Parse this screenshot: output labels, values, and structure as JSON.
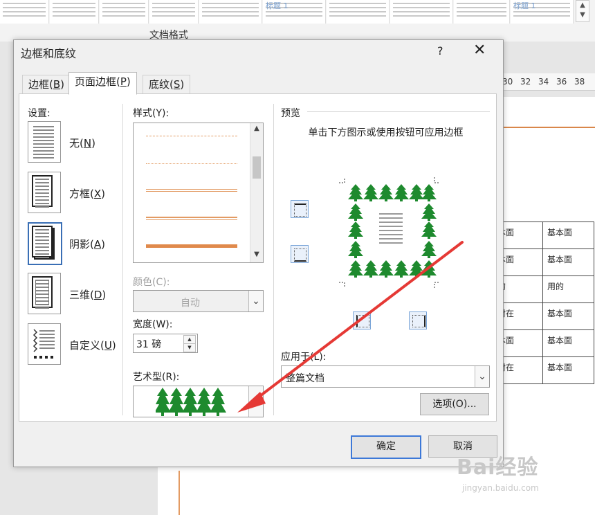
{
  "background": {
    "ribbon_heading_1": "标题 1",
    "ribbon_heading_2": "标题 1",
    "styles_group_label": "文档格式",
    "ruler_ticks": [
      "30",
      "32",
      "34",
      "36",
      "38"
    ],
    "table_rows": [
      [
        "基本面",
        "基本面"
      ],
      [
        "基本面",
        "基本面"
      ],
      [
        "用的",
        "用的"
      ],
      [
        "素材在",
        "基本面"
      ],
      [
        "基本面",
        "基本面"
      ],
      [
        "素材在",
        "基本面"
      ]
    ],
    "watermark": {
      "brand": "Bai",
      "brand2": "经验",
      "url": "jingyan.baidu.com"
    }
  },
  "dialog": {
    "title": "边框和底纹",
    "help": "?",
    "close": "✕",
    "tabs": [
      {
        "label": "边框(",
        "key": "B",
        "tail": ")"
      },
      {
        "label": "页面边框(",
        "key": "P",
        "tail": ")"
      },
      {
        "label": "底纹(",
        "key": "S",
        "tail": ")"
      }
    ],
    "settings": {
      "heading": "设置:",
      "items": [
        {
          "label": "无(",
          "key": "N",
          "tail": ")"
        },
        {
          "label": "方框(",
          "key": "X",
          "tail": ")"
        },
        {
          "label": "阴影(",
          "key": "A",
          "tail": ")"
        },
        {
          "label": "三维(",
          "key": "D",
          "tail": ")"
        },
        {
          "label": "自定义(",
          "key": "U",
          "tail": ")"
        }
      ]
    },
    "style": {
      "heading": "样式(Y):",
      "color_label": "颜色(C):",
      "color_value": "自动",
      "width_label": "宽度(W):",
      "width_value": "31 磅",
      "art_label": "艺术型(R):",
      "art_icon": "tree-icon"
    },
    "preview": {
      "heading": "预览",
      "hint": "单击下方图示或使用按钮可应用边框",
      "apply_label": "应用于(L):",
      "apply_value": "整篇文档",
      "options_button": "选项(O)..."
    },
    "ok_button": "确定",
    "cancel_button": "取消"
  },
  "colors": {
    "accent": "#3c78d8",
    "border_line": "#e39b63",
    "tree": "#1e8a2e",
    "arrow": "#e53935"
  }
}
